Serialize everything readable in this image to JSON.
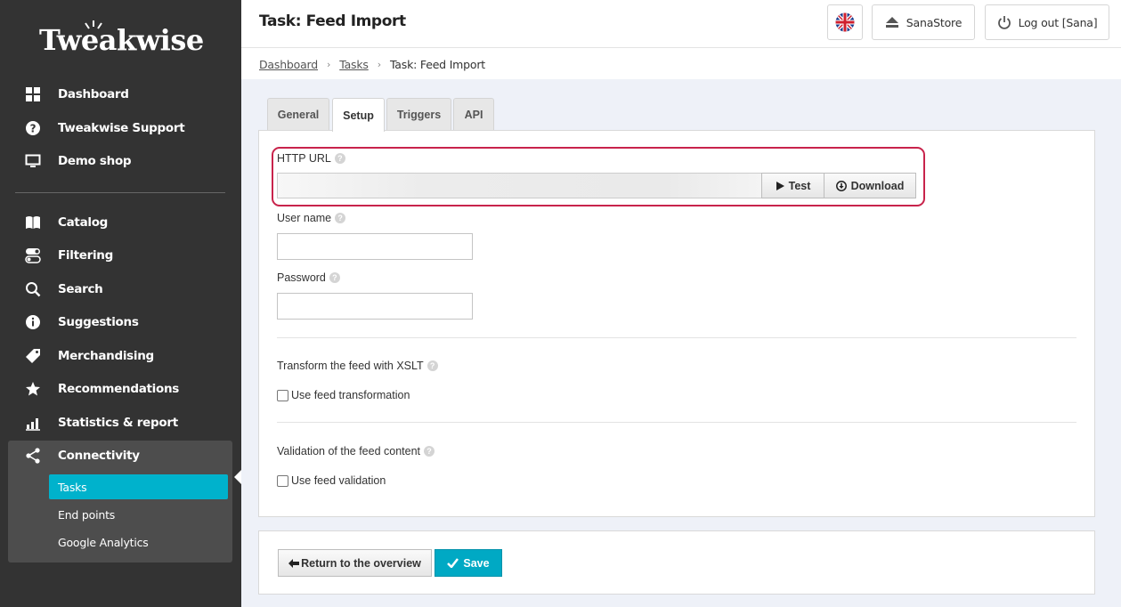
{
  "brand": {
    "logo_text": "Tweakwise"
  },
  "sidebar": {
    "items": [
      {
        "label": "Dashboard",
        "icon": "grid-icon"
      },
      {
        "label": "Tweakwise Support",
        "icon": "question-circle-icon"
      },
      {
        "label": "Demo shop",
        "icon": "monitor-icon"
      },
      {
        "label": "Catalog",
        "icon": "open-book-icon"
      },
      {
        "label": "Filtering",
        "icon": "toggle-icon"
      },
      {
        "label": "Search",
        "icon": "search-icon"
      },
      {
        "label": "Suggestions",
        "icon": "info-circle-icon"
      },
      {
        "label": "Merchandising",
        "icon": "tag-icon"
      },
      {
        "label": "Recommendations",
        "icon": "star-icon"
      },
      {
        "label": "Statistics & report",
        "icon": "bar-chart-icon"
      },
      {
        "label": "Connectivity",
        "icon": "share-icon"
      }
    ],
    "connectivity_sub": [
      {
        "label": "Tasks",
        "active": true
      },
      {
        "label": "End points",
        "active": false
      },
      {
        "label": "Google Analytics",
        "active": false
      }
    ]
  },
  "header": {
    "title": "Task: Feed Import",
    "language_icon": "uk-flag-icon",
    "store_label": "SanaStore",
    "logout_label": "Log out [Sana]"
  },
  "breadcrumb": {
    "items": [
      "Dashboard",
      "Tasks"
    ],
    "current": "Task: Feed Import",
    "separator": "›"
  },
  "tabs": [
    {
      "label": "General",
      "active": false
    },
    {
      "label": "Setup",
      "active": true
    },
    {
      "label": "Triggers",
      "active": false
    },
    {
      "label": "API",
      "active": false
    }
  ],
  "form": {
    "http_url_label": "HTTP URL",
    "http_url_value": "",
    "test_label": "Test",
    "download_label": "Download",
    "username_label": "User name",
    "username_value": "",
    "password_label": "Password",
    "password_value": "",
    "xslt_heading": "Transform the feed with XSLT",
    "use_transformation_label": "Use feed transformation",
    "use_transformation_checked": false,
    "validation_heading": "Validation of the feed content",
    "use_validation_label": "Use feed validation",
    "use_validation_checked": false,
    "help_glyph": "?"
  },
  "actions": {
    "return_label": "Return to the overview",
    "save_label": "Save"
  },
  "colors": {
    "sidebar_bg": "#333333",
    "accent": "#00b2cc",
    "highlight_border": "#c8234b"
  }
}
